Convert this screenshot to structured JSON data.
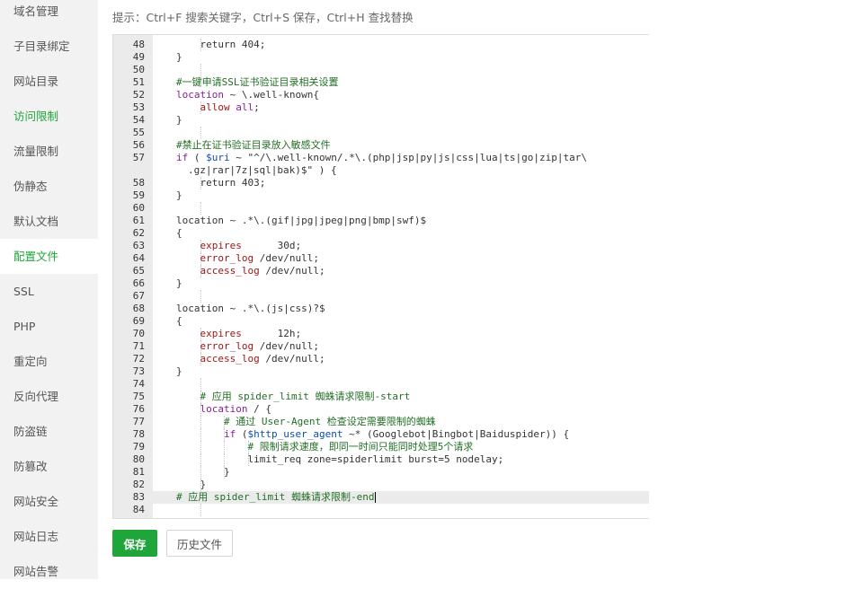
{
  "sidebar": {
    "items": [
      {
        "label": "域名管理",
        "name": "sidebar-item-domain"
      },
      {
        "label": "子目录绑定",
        "name": "sidebar-item-subdir-bind"
      },
      {
        "label": "网站目录",
        "name": "sidebar-item-site-dir"
      },
      {
        "label": "访问限制",
        "name": "sidebar-item-access-limit"
      },
      {
        "label": "流量限制",
        "name": "sidebar-item-traffic-limit"
      },
      {
        "label": "伪静态",
        "name": "sidebar-item-rewrite"
      },
      {
        "label": "默认文档",
        "name": "sidebar-item-default-doc"
      },
      {
        "label": "配置文件",
        "name": "sidebar-item-config-file"
      },
      {
        "label": "SSL",
        "name": "sidebar-item-ssl"
      },
      {
        "label": "PHP",
        "name": "sidebar-item-php"
      },
      {
        "label": "重定向",
        "name": "sidebar-item-redirect"
      },
      {
        "label": "反向代理",
        "name": "sidebar-item-reverse-proxy"
      },
      {
        "label": "防盗链",
        "name": "sidebar-item-hotlink"
      },
      {
        "label": "防篡改",
        "name": "sidebar-item-tamper"
      },
      {
        "label": "网站安全",
        "name": "sidebar-item-site-security"
      },
      {
        "label": "网站日志",
        "name": "sidebar-item-site-log"
      },
      {
        "label": "网站告警",
        "name": "sidebar-item-site-alert"
      }
    ],
    "active_index": 7,
    "highlight_index": 3,
    "accent_color": "#20a53a"
  },
  "hint": "提示：Ctrl+F 搜索关键字，Ctrl+S 保存，Ctrl+H 查找替换",
  "editor": {
    "lines": [
      {
        "n": "48",
        "indent": 2,
        "segs": [
          [
            "",
            "return 404;"
          ]
        ]
      },
      {
        "n": "49",
        "indent": 1,
        "segs": [
          [
            "",
            "}"
          ]
        ]
      },
      {
        "n": "50",
        "indent": 0,
        "segs": []
      },
      {
        "n": "51",
        "indent": 1,
        "segs": [
          [
            "cm",
            "#一键申请SSL证书验证目录相关设置"
          ]
        ]
      },
      {
        "n": "52",
        "indent": 1,
        "segs": [
          [
            "kw",
            "location"
          ],
          [
            "",
            " ~ \\.well-known{"
          ]
        ]
      },
      {
        "n": "53",
        "indent": 2,
        "segs": [
          [
            "dir",
            "allow"
          ],
          [
            "",
            " "
          ],
          [
            "kw",
            "all"
          ],
          [
            "",
            ";"
          ]
        ]
      },
      {
        "n": "54",
        "indent": 1,
        "segs": [
          [
            "",
            "}"
          ]
        ]
      },
      {
        "n": "55",
        "indent": 0,
        "segs": []
      },
      {
        "n": "56",
        "indent": 1,
        "segs": [
          [
            "cm",
            "#禁止在证书验证目录放入敏感文件"
          ]
        ]
      },
      {
        "n": "57",
        "indent": 1,
        "segs": [
          [
            "kw",
            "if"
          ],
          [
            "",
            " ( "
          ],
          [
            "var",
            "$uri"
          ],
          [
            "",
            " ~ \"^/\\.well-known/.*\\.(php|jsp|py|js|css|lua|ts|go|zip|tar\\"
          ]
        ]
      },
      {
        "n": "",
        "indent": 1,
        "extra": "  ",
        "segs": [
          [
            "",
            ".gz|rar|7z|sql|bak)$\" ) {"
          ]
        ]
      },
      {
        "n": "58",
        "indent": 2,
        "segs": [
          [
            "",
            "return 403;"
          ]
        ]
      },
      {
        "n": "59",
        "indent": 1,
        "segs": [
          [
            "",
            "}"
          ]
        ]
      },
      {
        "n": "60",
        "indent": 0,
        "segs": []
      },
      {
        "n": "61",
        "indent": 1,
        "segs": [
          [
            "",
            "location ~ .*\\.(gif|jpg|jpeg|png|bmp|swf)$"
          ]
        ]
      },
      {
        "n": "62",
        "indent": 1,
        "segs": [
          [
            "",
            "{"
          ]
        ]
      },
      {
        "n": "63",
        "indent": 2,
        "segs": [
          [
            "dir",
            "expires"
          ],
          [
            "",
            "      30d;"
          ]
        ]
      },
      {
        "n": "64",
        "indent": 2,
        "segs": [
          [
            "dir",
            "error_log"
          ],
          [
            "",
            " /dev/null;"
          ]
        ]
      },
      {
        "n": "65",
        "indent": 2,
        "segs": [
          [
            "dir",
            "access_log"
          ],
          [
            "",
            " /dev/null;"
          ]
        ]
      },
      {
        "n": "66",
        "indent": 1,
        "segs": [
          [
            "",
            "}"
          ]
        ]
      },
      {
        "n": "67",
        "indent": 0,
        "segs": []
      },
      {
        "n": "68",
        "indent": 1,
        "segs": [
          [
            "",
            "location ~ .*\\.(js|css)?$"
          ]
        ]
      },
      {
        "n": "69",
        "indent": 1,
        "segs": [
          [
            "",
            "{"
          ]
        ]
      },
      {
        "n": "70",
        "indent": 2,
        "segs": [
          [
            "dir",
            "expires"
          ],
          [
            "",
            "      12h;"
          ]
        ]
      },
      {
        "n": "71",
        "indent": 2,
        "segs": [
          [
            "dir",
            "error_log"
          ],
          [
            "",
            " /dev/null;"
          ]
        ]
      },
      {
        "n": "72",
        "indent": 2,
        "segs": [
          [
            "dir",
            "access_log"
          ],
          [
            "",
            " /dev/null;"
          ]
        ]
      },
      {
        "n": "73",
        "indent": 1,
        "segs": [
          [
            "",
            "}"
          ]
        ]
      },
      {
        "n": "74",
        "indent": 0,
        "segs": []
      },
      {
        "n": "75",
        "indent": 2,
        "segs": [
          [
            "cm",
            "# 应用 spider_limit 蜘蛛请求限制-start"
          ]
        ]
      },
      {
        "n": "76",
        "indent": 2,
        "segs": [
          [
            "kw",
            "location"
          ],
          [
            "",
            " / {"
          ]
        ]
      },
      {
        "n": "77",
        "indent": 3,
        "segs": [
          [
            "cm",
            "# 通过 User-Agent 检查设定需要限制的蜘蛛"
          ]
        ]
      },
      {
        "n": "78",
        "indent": 3,
        "segs": [
          [
            "kw",
            "if"
          ],
          [
            "",
            " ("
          ],
          [
            "var",
            "$http_user_agent"
          ],
          [
            "",
            " ~* (Googlebot|Bingbot|Baiduspider)) {"
          ]
        ]
      },
      {
        "n": "79",
        "indent": 4,
        "segs": [
          [
            "cm",
            "# 限制请求速度，即同一时间只能同时处理5个请求"
          ]
        ]
      },
      {
        "n": "80",
        "indent": 4,
        "segs": [
          [
            "",
            "limit_req zone=spiderlimit burst=5 nodelay;"
          ]
        ]
      },
      {
        "n": "81",
        "indent": 3,
        "segs": [
          [
            "",
            "}"
          ]
        ]
      },
      {
        "n": "82",
        "indent": 2,
        "segs": [
          [
            "",
            "}"
          ]
        ]
      },
      {
        "n": "83",
        "indent": 1,
        "active": true,
        "segs": [
          [
            "cm",
            "# 应用 spider_limit 蜘蛛请求限制-end"
          ]
        ]
      },
      {
        "n": "84",
        "indent": 0,
        "segs": []
      }
    ]
  },
  "buttons": {
    "save": "保存",
    "history": "历史文件"
  }
}
